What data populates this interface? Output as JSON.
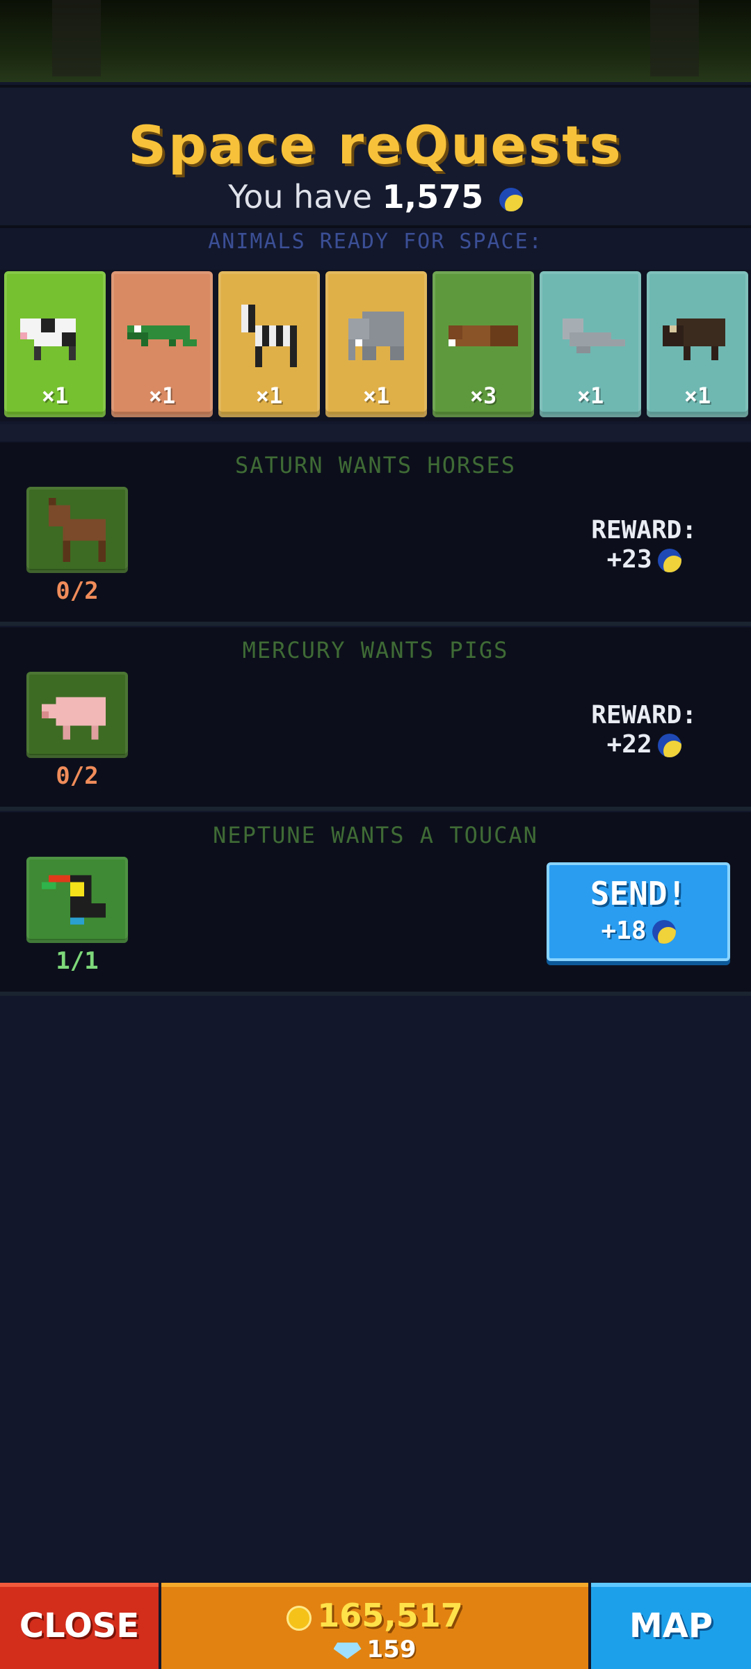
{
  "header": {
    "title": "Space reQuests",
    "have_prefix": "You have",
    "have_amount": "1,575"
  },
  "animals_label": "ANIMALS READY FOR SPACE:",
  "animals": [
    {
      "name": "cow",
      "count": "×1",
      "color": "#76c12f"
    },
    {
      "name": "crocodile",
      "count": "×1",
      "color": "#d98a62"
    },
    {
      "name": "zebra",
      "count": "×1",
      "color": "#e0b048"
    },
    {
      "name": "elephant",
      "count": "×1",
      "color": "#e0b048"
    },
    {
      "name": "beaver",
      "count": "×3",
      "color": "#5e9a3d"
    },
    {
      "name": "seal",
      "count": "×1",
      "color": "#6fb8b2"
    },
    {
      "name": "musk-ox",
      "count": "×1",
      "color": "#6fb8b2"
    }
  ],
  "requests": [
    {
      "title": "SATURN WANTS HORSES",
      "animal": "horse",
      "progress": "0/2",
      "reward_label": "REWARD:",
      "reward": "+23"
    },
    {
      "title": "MERCURY WANTS PIGS",
      "animal": "pig",
      "progress": "0/2",
      "reward_label": "REWARD:",
      "reward": "+22"
    },
    {
      "title": "NEPTUNE WANTS A TOUCAN",
      "animal": "toucan",
      "progress": "1/1",
      "send_label": "SEND!",
      "reward": "+18"
    }
  ],
  "bottom": {
    "close_label": "CLOSE",
    "gold": "165,517",
    "gems": "159",
    "map_label": "MAP"
  }
}
